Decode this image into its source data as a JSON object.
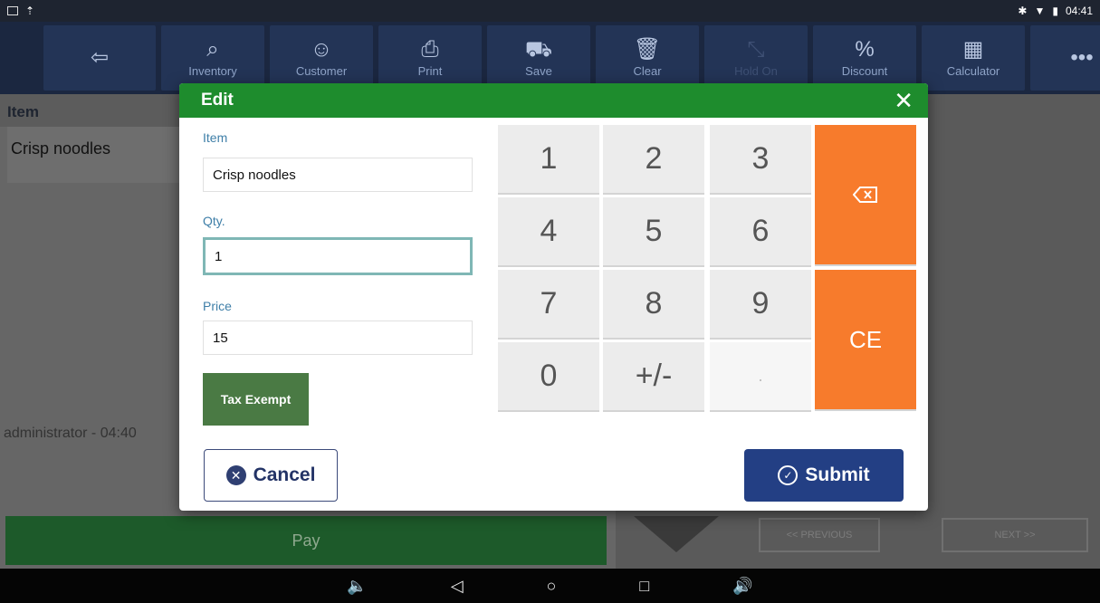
{
  "status_bar": {
    "time": "04:41",
    "icons": [
      "image-icon",
      "upload-icon",
      "bluetooth-icon",
      "wifi-icon",
      "battery-icon"
    ]
  },
  "toolbar": {
    "items": [
      {
        "label": "",
        "icon": "back-arrow-icon"
      },
      {
        "label": "Inventory",
        "icon": "search-icon"
      },
      {
        "label": "Customer",
        "icon": "person-icon"
      },
      {
        "label": "Print",
        "icon": "printer-icon"
      },
      {
        "label": "Save",
        "icon": "cart-icon"
      },
      {
        "label": "Clear",
        "icon": "trash-icon"
      },
      {
        "label": "Hold On",
        "icon": "hold-icon",
        "disabled": true
      },
      {
        "label": "Discount",
        "icon": "percent-icon"
      },
      {
        "label": "Calculator",
        "icon": "calculator-icon"
      },
      {
        "label": "",
        "icon": "more-icon"
      }
    ]
  },
  "background": {
    "header": "Item",
    "row_item": "Crisp noodles",
    "admin_text": "administrator - 04:40",
    "pay_label": "Pay",
    "prev_label": "<< PREVIOUS",
    "next_label": "NEXT >>"
  },
  "dialog": {
    "title": "Edit",
    "item_label": "Item",
    "item_value": "Crisp noodles",
    "qty_label": "Qty.",
    "qty_value": "1",
    "price_label": "Price",
    "price_value": "15",
    "tax_exempt_label": "Tax Exempt",
    "keypad": [
      "1",
      "2",
      "3",
      "4",
      "5",
      "6",
      "7",
      "8",
      "9",
      "0",
      "+/-",
      "."
    ],
    "ce_label": "CE",
    "cancel_label": "Cancel",
    "submit_label": "Submit",
    "colors": {
      "header": "#1e8c2d",
      "keypad_action": "#f77b2c",
      "submit": "#233f84",
      "tax_exempt": "#4a7a44"
    }
  },
  "nav_bar": {
    "icons": [
      "volume-down-icon",
      "back-icon",
      "home-icon",
      "recents-icon",
      "volume-up-icon"
    ]
  }
}
